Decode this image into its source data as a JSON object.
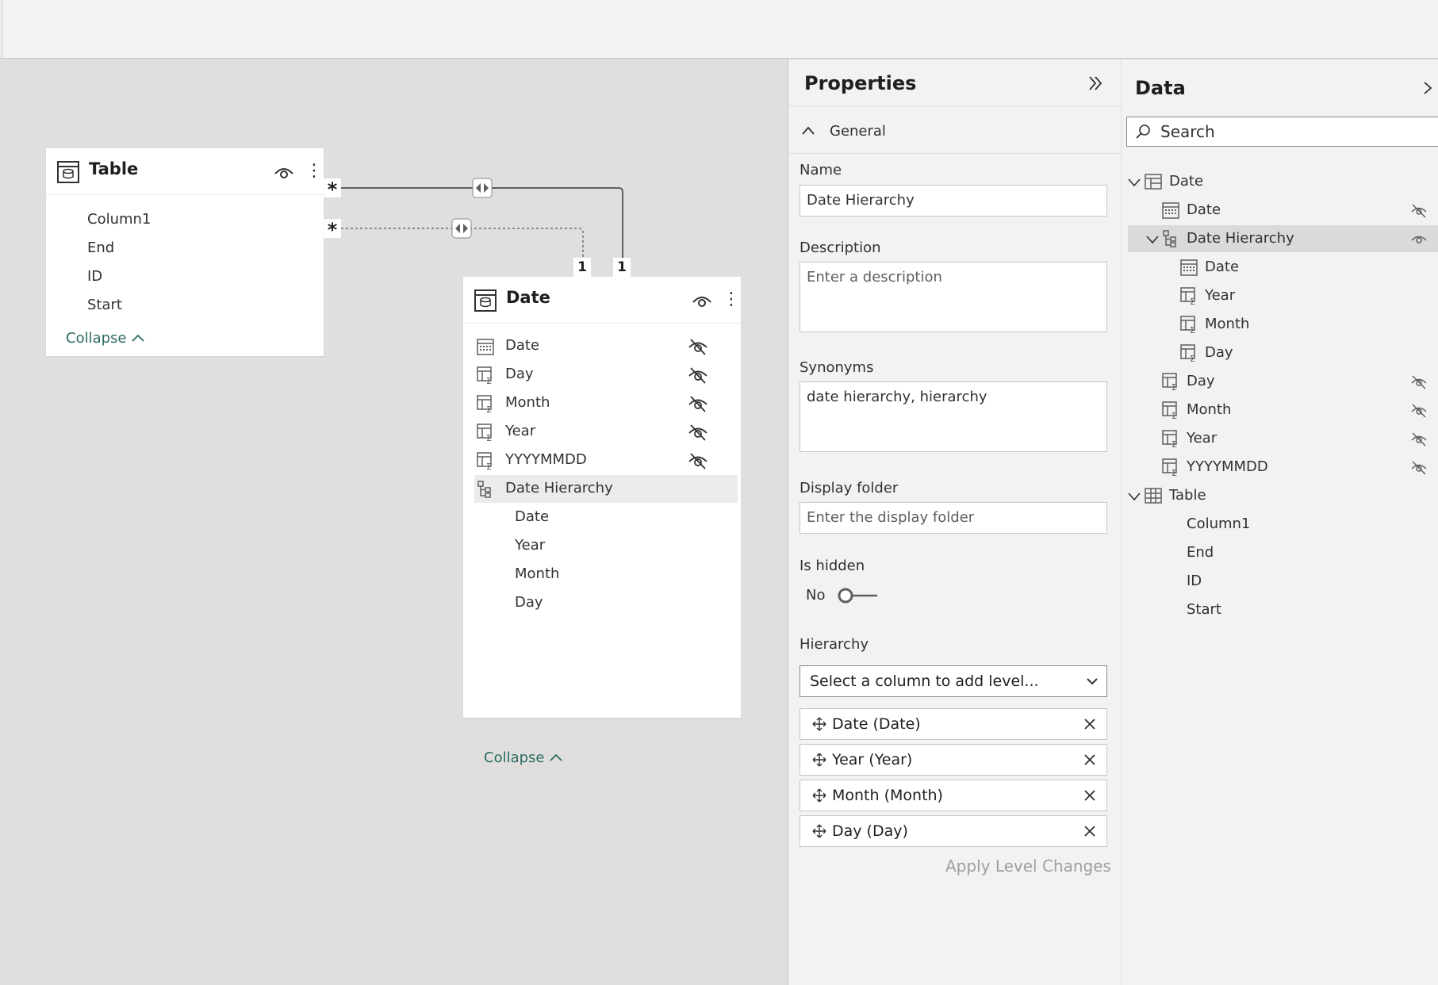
{
  "model_view": {
    "table_card": {
      "title": "Table",
      "fields": [
        "Column1",
        "End",
        "ID",
        "Start"
      ],
      "collapse_label": "Collapse"
    },
    "date_card": {
      "title": "Date",
      "fields": [
        "Date",
        "Day",
        "Month",
        "Year",
        "YYYYMMDD"
      ],
      "hierarchy": "Date Hierarchy",
      "hierarchy_levels": [
        "Date",
        "Year",
        "Month",
        "Day"
      ],
      "collapse_label": "Collapse"
    },
    "relationships": [
      {
        "from_cardinality": "*",
        "to_cardinality": "1",
        "style": "solid"
      },
      {
        "from_cardinality": "*",
        "to_cardinality": "1",
        "style": "dotted"
      }
    ]
  },
  "properties": {
    "title": "Properties",
    "section": "General",
    "name_label": "Name",
    "name_value": "Date Hierarchy",
    "description_label": "Description",
    "description_placeholder": "Enter a description",
    "synonyms_label": "Synonyms",
    "synonyms_value": "date hierarchy, hierarchy",
    "display_folder_label": "Display folder",
    "display_folder_placeholder": "Enter the display folder",
    "is_hidden_label": "Is hidden",
    "is_hidden_value": "No",
    "hierarchy_label": "Hierarchy",
    "hierarchy_select": "Select a column to add level...",
    "levels": [
      "Date (Date)",
      "Year (Year)",
      "Month (Month)",
      "Day (Day)"
    ],
    "apply_label": "Apply Level Changes"
  },
  "data_pane": {
    "title": "Data",
    "search_placeholder": "Search",
    "tree": {
      "date_table": "Date",
      "date_fields": [
        "Date",
        "Date Hierarchy",
        "Date",
        "Year",
        "Month",
        "Day",
        "Day",
        "Month",
        "Year",
        "YYYYMMDD"
      ],
      "table_table": "Table",
      "table_fields": [
        "Column1",
        "End",
        "ID",
        "Start"
      ]
    }
  },
  "colors": {
    "canvas": "#e1dfdd",
    "panel": "#f3f2f1",
    "accent_link": "#2b6a63",
    "selected_row": "#edebe9"
  }
}
